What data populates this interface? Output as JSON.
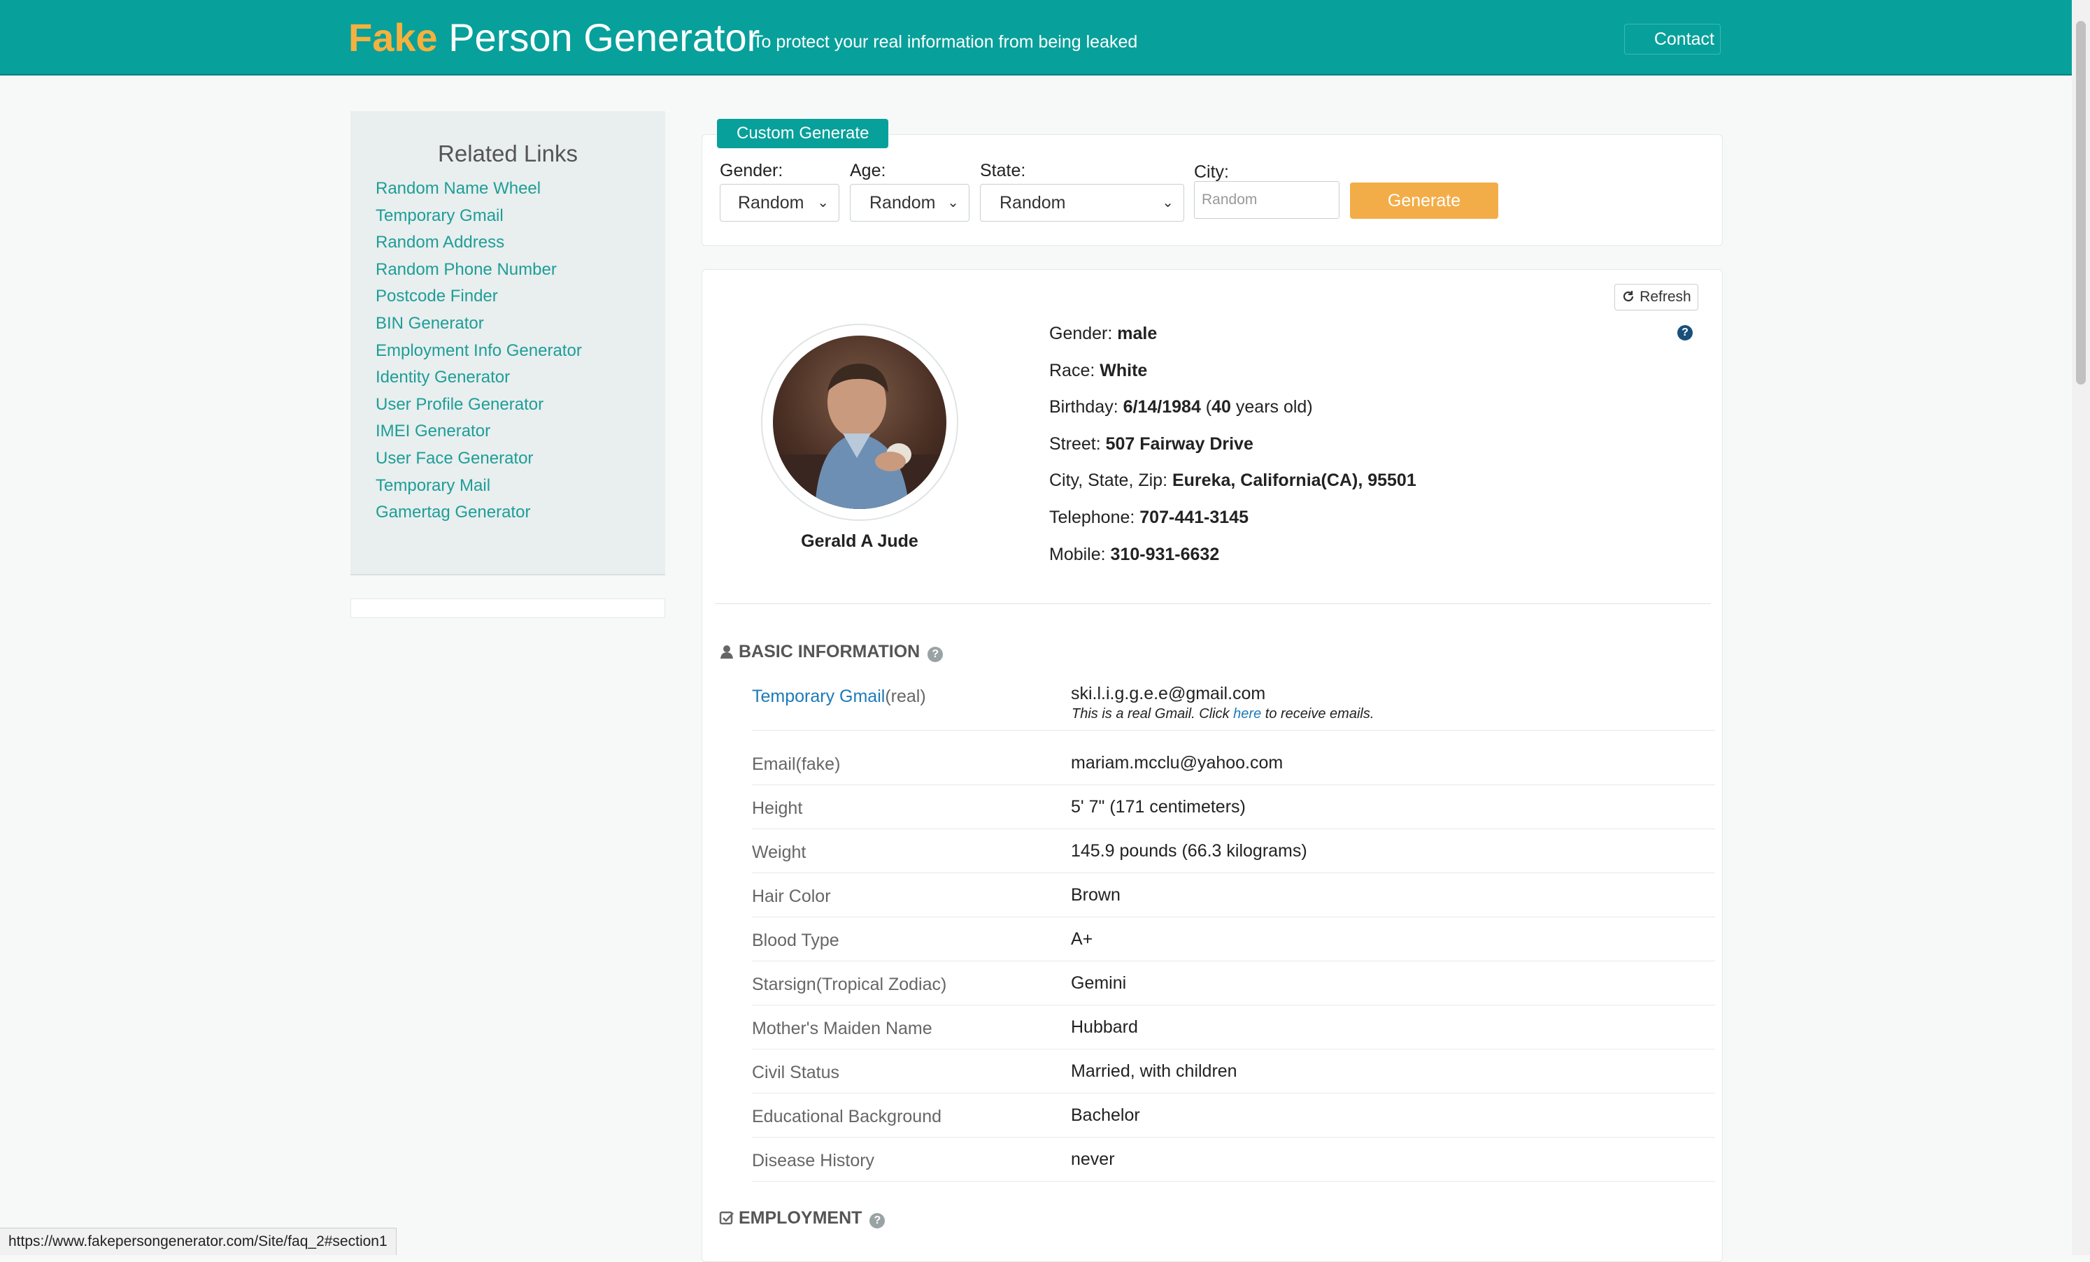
{
  "header": {
    "logo_fake": "Fake",
    "logo_rest": "Person Generator",
    "tagline": "To protect your real information from being leaked",
    "contact_label": "Contact"
  },
  "sidebar": {
    "title": "Related Links",
    "links": [
      "Random Name Wheel",
      "Temporary Gmail",
      "Random Address",
      "Random Phone Number",
      "Postcode Finder",
      "BIN Generator",
      "Employment Info Generator",
      "Identity Generator",
      "User Profile Generator",
      "IMEI Generator",
      "User Face Generator",
      "Temporary Mail",
      "Gamertag Generator"
    ]
  },
  "custom": {
    "tab_label": "Custom Generate",
    "gender_label": "Gender:",
    "gender_value": "Random",
    "age_label": "Age:",
    "age_value": "Random",
    "state_label": "State:",
    "state_value": "Random",
    "city_label": "City:",
    "city_placeholder": "Random",
    "generate_label": "Generate"
  },
  "profile": {
    "refresh_label": "Refresh",
    "name": "Gerald A Jude",
    "gender_label": "Gender:",
    "gender": "male",
    "race_label": "Race:",
    "race": "White",
    "birthday_label": "Birthday:",
    "birthday": "6/14/1984",
    "age_open": "(",
    "age": "40",
    "age_suffix": "years old)",
    "street_label": "Street:",
    "street": "507 Fairway Drive",
    "citystatezip_label": "City, State, Zip:",
    "citystatezip": "Eureka, California(CA), 95501",
    "telephone_label": "Telephone:",
    "telephone": "707-441-3145",
    "mobile_label": "Mobile:",
    "mobile": "310-931-6632"
  },
  "basic": {
    "title": "BASIC INFORMATION",
    "gmail_link": "Temporary Gmail",
    "gmail_suffix": "(real)",
    "gmail_value": "ski.l.i.g.g.e.e@gmail.com",
    "gmail_note_pre": "This is a real Gmail. Click",
    "gmail_note_link": "here",
    "gmail_note_post": "to receive emails.",
    "rows": [
      {
        "label": "Email(fake)",
        "value": "mariam.mcclu@yahoo.com"
      },
      {
        "label": "Height",
        "value": "5' 7\" (171 centimeters)"
      },
      {
        "label": "Weight",
        "value": "145.9 pounds (66.3 kilograms)"
      },
      {
        "label": "Hair Color",
        "value": "Brown"
      },
      {
        "label": "Blood Type",
        "value": "A+"
      },
      {
        "label": "Starsign(Tropical Zodiac)",
        "value": "Gemini"
      },
      {
        "label": "Mother's Maiden Name",
        "value": "Hubbard"
      },
      {
        "label": "Civil Status",
        "value": "Married, with children"
      },
      {
        "label": "Educational Background",
        "value": "Bachelor"
      },
      {
        "label": "Disease History",
        "value": "never"
      }
    ]
  },
  "employment": {
    "title": "EMPLOYMENT"
  },
  "statusbar": {
    "url": "https://www.fakepersongenerator.com/Site/faq_2#section1"
  }
}
